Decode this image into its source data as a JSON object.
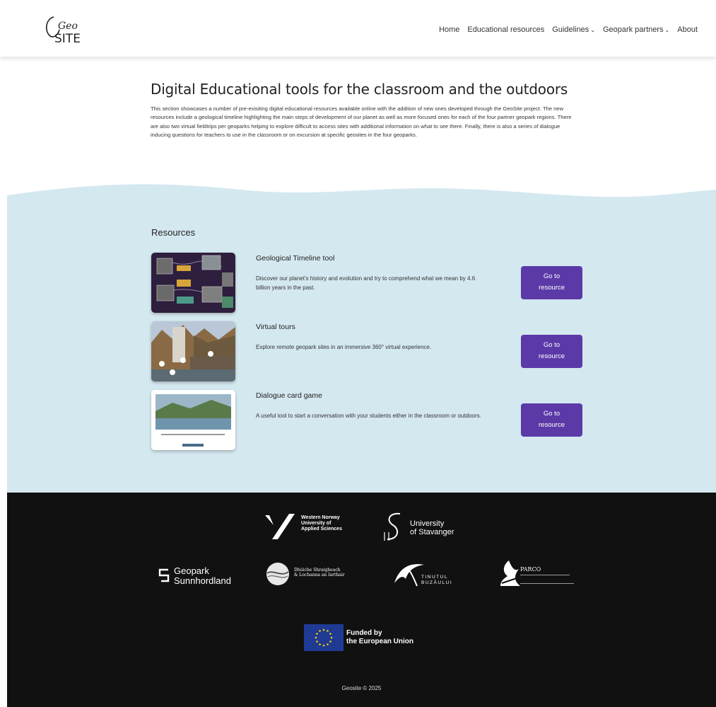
{
  "header": {
    "logo_top": "Geo",
    "logo_bottom": "SITE",
    "nav": [
      {
        "label": "Home",
        "dropdown": false
      },
      {
        "label": "Educational resources",
        "dropdown": false
      },
      {
        "label": "Guidelines",
        "dropdown": true
      },
      {
        "label": "Geopark partners",
        "dropdown": true
      },
      {
        "label": "About",
        "dropdown": false
      }
    ]
  },
  "intro": {
    "title": "Digital Educational tools for the classroom and the outdoors",
    "body": "This section showcases a number of pre-exisiting digital educational resources available online with the addition of new ones developed through the GeoSite project. The new resources include a geological timeline highlighting the main steps of development of our planet as well as more focused ones for each of the four partner geopark regions. There are also two virtual fieldtrips per geoparks helping to explore difficult to access sites with additional information on what to see there. Finally, there is also a series of dialogue inducing questions for teachers to use in the classroom or on excursion at specific geosites in the four geoparks."
  },
  "resources": {
    "heading": "Resources",
    "items": [
      {
        "title": "Geological Timeline tool",
        "description": "Discover our planet's history and evolution and try to comprehend what we mean by 4.6 billion years in the past.",
        "button": "Go to resource"
      },
      {
        "title": "Virtual tours",
        "description": "Explore remote geopark sites in an immersive 360° virtual experience.",
        "button": "Go to resource"
      },
      {
        "title": "Dialogue card game",
        "description": "A useful tool to start a conversation with your students either in the classroom or outdoors.",
        "button": "Go to resource"
      }
    ]
  },
  "footer": {
    "hvl": [
      "Western Norway",
      "University of",
      "Applied Sciences"
    ],
    "uis": [
      "University",
      "of Stavanger"
    ],
    "sunnhordland": [
      "Geopark",
      "Sunnhordland"
    ],
    "donegal": [
      "Dhúiche Shraigheach",
      "& Lochanna an Iarthair"
    ],
    "buzau": [
      "TINUTUL",
      "BUZĂULUI"
    ],
    "parco": "PARCO",
    "eu": [
      "Funded by",
      "the European Union"
    ],
    "copyright": "Geosite © 2025"
  },
  "colors": {
    "accent": "#5b3aa8",
    "band": "#d4e8f0",
    "footer": "#111111"
  }
}
